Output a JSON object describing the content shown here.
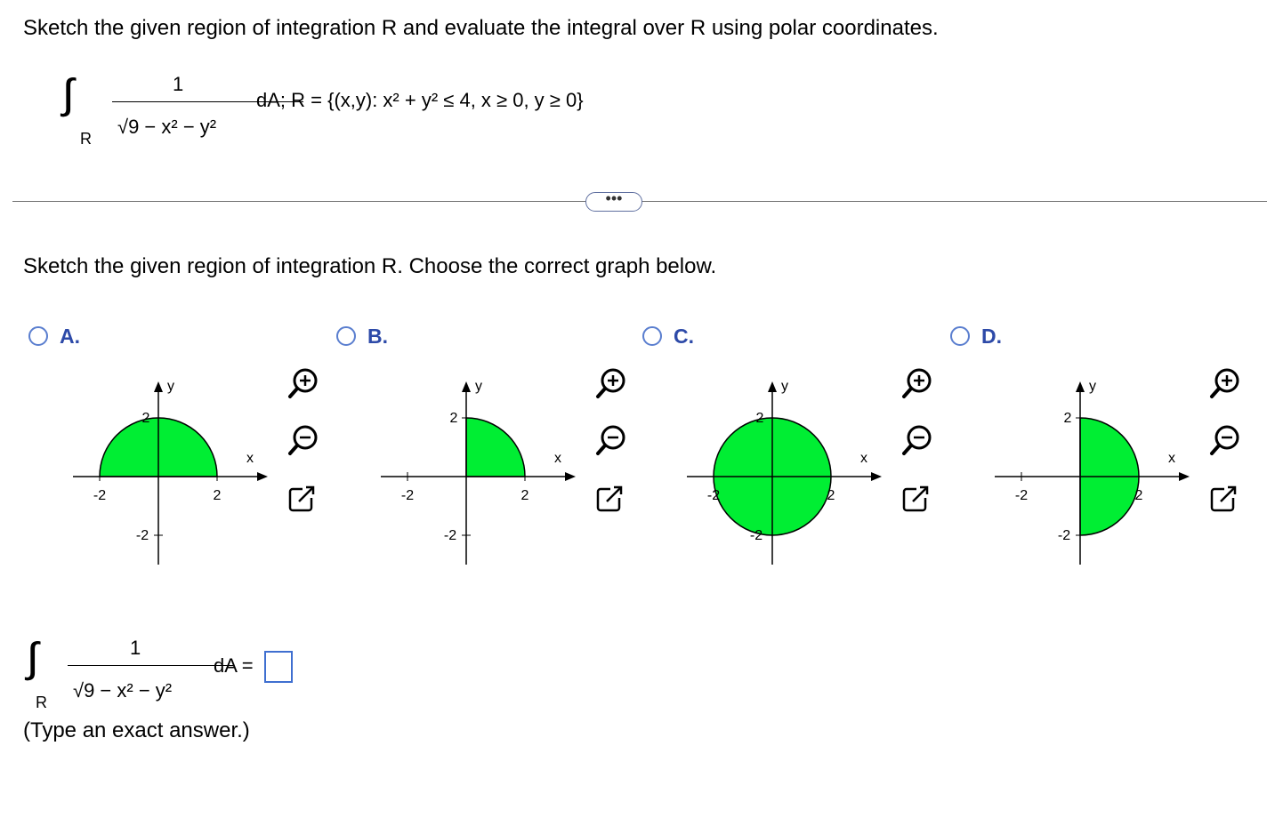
{
  "instructions": "Sketch the given region of integration R and evaluate the integral over R using polar coordinates.",
  "integral": {
    "sign": "∫∫",
    "region": "R",
    "numerator": "1",
    "denominator": "√9 − x² − y²",
    "rest": "dA; R = {(x,y): x² + y² ≤ 4, x ≥ 0, y ≥ 0}"
  },
  "more_button": "•••",
  "question": "Sketch the given region of integration R. Choose the correct graph below.",
  "options": [
    {
      "letter": "A.",
      "region": "upper-half-disk"
    },
    {
      "letter": "B.",
      "region": "first-quadrant"
    },
    {
      "letter": "C.",
      "region": "full-disk"
    },
    {
      "letter": "D.",
      "region": "right-half-disk"
    }
  ],
  "graph": {
    "x_label": "x",
    "y_label": "y",
    "tick_pos": "2",
    "tick_neg": "-2",
    "radius": 2,
    "range": [
      -3,
      3
    ],
    "fill_color": "#00ee33",
    "line_color": "#000000"
  },
  "answer": {
    "region": "R",
    "numerator": "1",
    "denominator": "√9 − x² − y²",
    "suffix": "dA =",
    "value": "",
    "hint": "(Type an exact answer.)"
  },
  "colors": {
    "accent": "#2d4aa8",
    "radio": "#5a7ecf",
    "divider": "#6f6f6f"
  },
  "icons": [
    "zoom-in-icon",
    "zoom-out-icon",
    "popout-icon"
  ]
}
